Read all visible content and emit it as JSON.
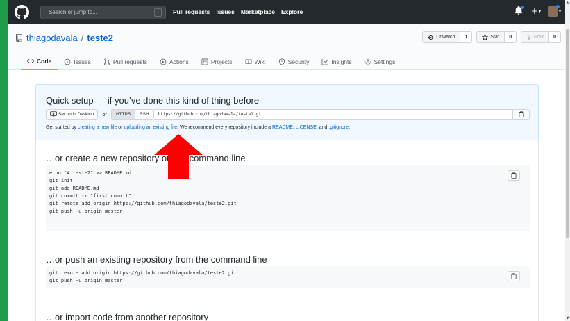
{
  "header": {
    "search_placeholder": "Search or jump to...",
    "search_key": "/",
    "nav": [
      "Pull requests",
      "Issues",
      "Marketplace",
      "Explore"
    ]
  },
  "repo": {
    "owner": "thiagodavala",
    "separator": "/",
    "name": "teste2",
    "actions": {
      "unwatch_label": "Unwatch",
      "watch_count": "1",
      "star_label": "Star",
      "star_count": "0",
      "fork_label": "Fork",
      "fork_count": "0"
    },
    "tabs": [
      {
        "label": "Code",
        "icon": "code-icon"
      },
      {
        "label": "Issues",
        "icon": "issue-icon"
      },
      {
        "label": "Pull requests",
        "icon": "pull-request-icon"
      },
      {
        "label": "Actions",
        "icon": "play-icon"
      },
      {
        "label": "Projects",
        "icon": "project-icon"
      },
      {
        "label": "Wiki",
        "icon": "book-icon"
      },
      {
        "label": "Security",
        "icon": "shield-icon"
      },
      {
        "label": "Insights",
        "icon": "graph-icon"
      },
      {
        "label": "Settings",
        "icon": "gear-icon"
      }
    ]
  },
  "quick_setup": {
    "title": "Quick setup — if you’ve done this kind of thing before",
    "desktop_button": "Set up in Desktop",
    "or": "or",
    "https": "HTTPS",
    "ssh": "SSH",
    "url": "https://github.com/thiagodavala/teste2.git",
    "help": {
      "t1": "Get started by ",
      "l1": "creating a new file",
      "t2": " or ",
      "l2": "uploading an existing file",
      "t3": ". We recommend every repository include a ",
      "l3": "README",
      "t4": ", ",
      "l4": "LICENSE",
      "t5": ", and ",
      "l5": ".gitignore",
      "t6": "."
    }
  },
  "new_repo": {
    "title": "…or create a new repository on the command line",
    "lines": [
      "echo \"# teste2\" >> README.md",
      "git init",
      "git add README.md",
      "git commit -m \"first commit\"",
      "git remote add origin https://github.com/thiagodavala/teste2.git",
      "git push -u origin master"
    ]
  },
  "push_existing": {
    "title": "…or push an existing repository from the command line",
    "lines": [
      "git remote add origin https://github.com/thiagodavala/teste2.git",
      "git push -u origin master"
    ]
  },
  "import": {
    "title": "…or import code from another repository"
  },
  "colors": {
    "annotation_arrow": "#ff0000",
    "accent": "#0366d6",
    "background": "#1f9c4a"
  }
}
